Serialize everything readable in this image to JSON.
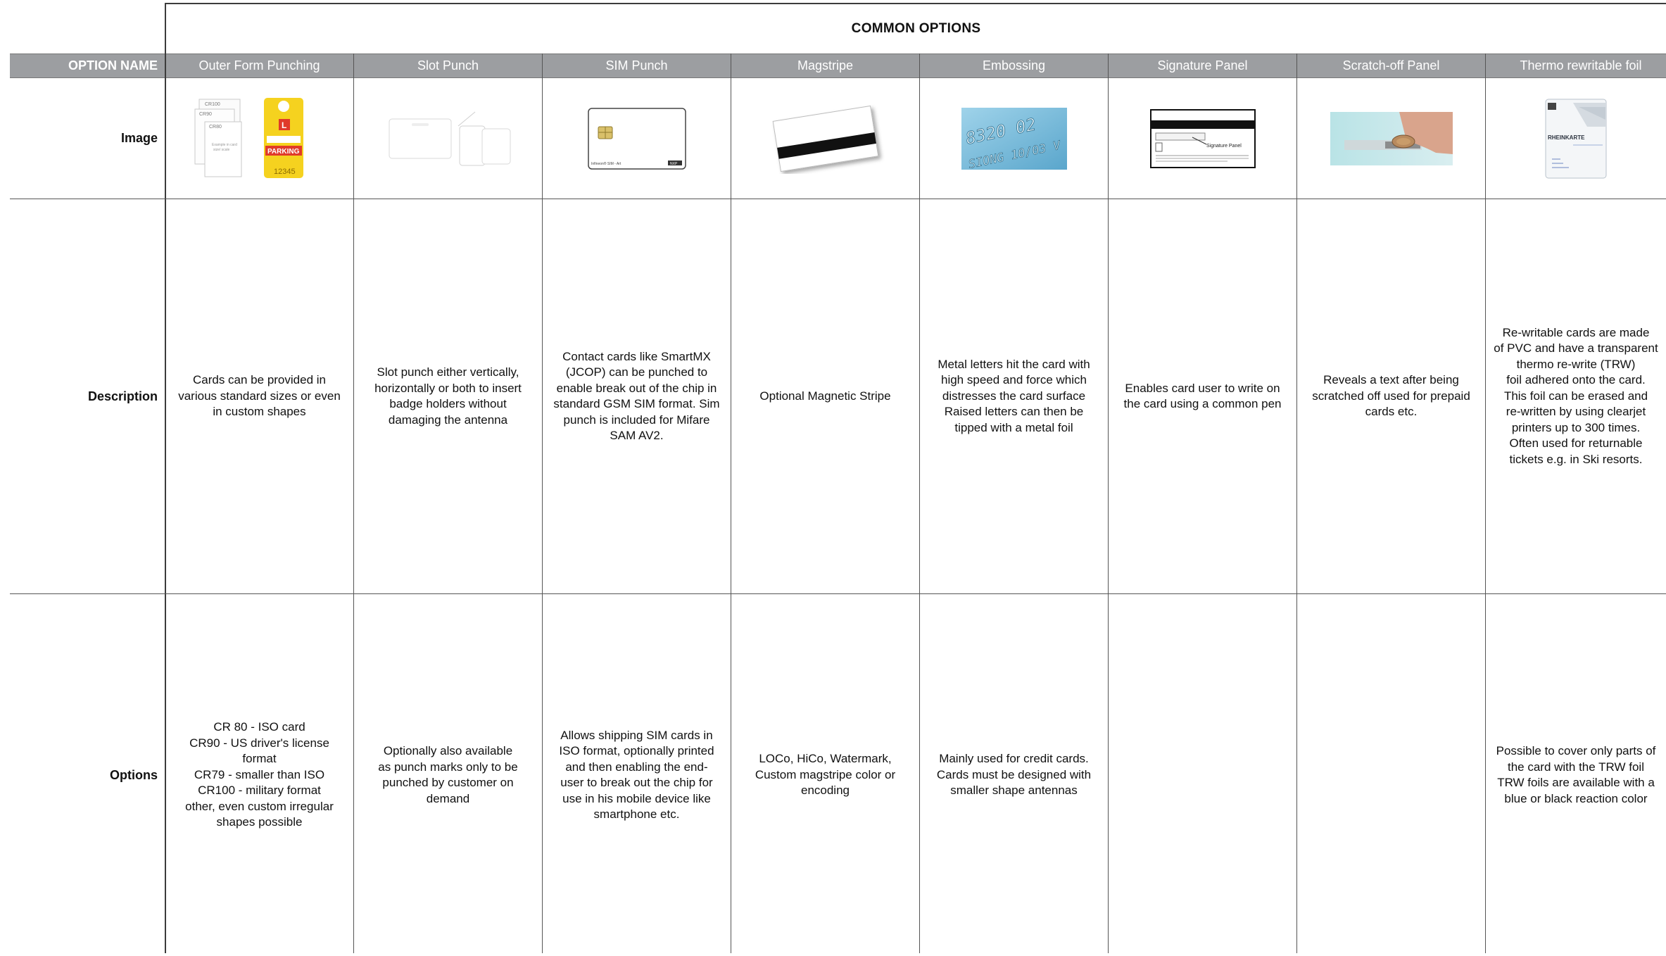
{
  "table": {
    "title": "COMMON OPTIONS",
    "header_first": "OPTION NAME",
    "columns": [
      "Outer Form Punching",
      "Slot Punch",
      "SIM Punch",
      "Magstripe",
      "Embossing",
      "Signature Panel",
      "Scratch-off Panel",
      "Thermo rewritable foil"
    ],
    "row_labels": {
      "image": "Image",
      "description": "Description",
      "options": "Options"
    },
    "descriptions": [
      "Cards can be provided in\nvarious standard sizes or even\nin custom shapes",
      "Slot punch either vertically,\nhorizontally or both to insert\nbadge holders without\ndamaging the antenna",
      "Contact cards like SmartMX\n(JCOP) can be punched to\nenable break out of the chip in\nstandard GSM SIM format. Sim\npunch  is included for Mifare\nSAM AV2.",
      "Optional Magnetic Stripe",
      "Metal letters hit the card with\nhigh speed  and force which\ndistresses the card surface\nRaised letters can then be\ntipped with a metal foil",
      "Enables card user to write on\nthe card using a common pen",
      "Reveals a text after being\nscratched off used for prepaid\ncards etc.",
      "Re-writable cards are made\nof PVC and have a transparent\nthermo re-write (TRW)\nfoil adhered onto the card.\nThis foil can be erased and\nre-written by using clearjet\nprinters up to 300 times.\nOften used for returnable\ntickets e.g. in Ski resorts."
    ],
    "options": [
      "CR 80 - ISO card\nCR90 - US driver's license\nformat\nCR79 - smaller than ISO\nCR100 - military format\nother, even custom irregular\nshapes possible",
      "Optionally also available\nas punch marks only to be\npunched by customer on\ndemand",
      "Allows shipping SIM cards in\nISO format, optionally printed\nand then enabling the end-\nuser to break out the chip for\nuse in his mobile device like\nsmartphone etc.",
      "LOCo, HiCo, Watermark,\nCustom magstripe color or\nencoding",
      "Mainly used for credit cards.\nCards must be designed with\nsmaller shape antennas",
      "",
      "",
      "Possible to cover only parts of\nthe card with the TRW foil\nTRW foils are available with a\nblue or black reaction color"
    ]
  },
  "image_texts": {
    "outer_form": {
      "card1": "CR100",
      "card2": "CR90",
      "card3": "CR80",
      "card_note": "Example in card\nsize/ scale",
      "tag_letter": "L",
      "tag_word": "PARKING",
      "tag_number": "12345"
    },
    "sim": {
      "caption": "Infineon® SIM - Art",
      "logo": "NXP"
    },
    "embossing": {
      "line1": "8320 02",
      "line2": "SIONG 10/03 V"
    },
    "signature": {
      "label": "Signature Panel"
    },
    "thermo": {
      "brand": "RHEINKARTE"
    }
  },
  "colors": {
    "header_bg": "#9c9ea1",
    "grid": "#3c3c3c",
    "parking_yellow": "#f5d21f",
    "parking_red": "#e03a2a",
    "emboss_blue": "#6fb6d8"
  }
}
